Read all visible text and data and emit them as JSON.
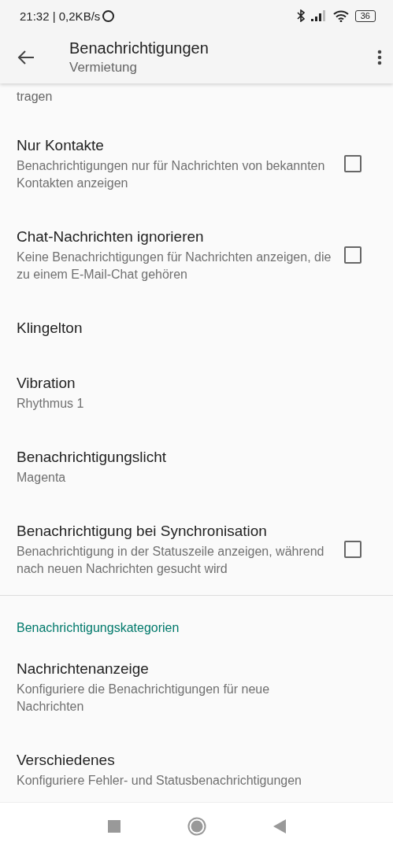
{
  "status_bar": {
    "text": "21:32 | 0,2KB/s",
    "battery": "36"
  },
  "app_bar": {
    "title": "Benachrichtigungen",
    "subtitle": "Vermietung"
  },
  "partial_summary": "tragen",
  "items": [
    {
      "kind": "checkbox",
      "title": "Nur Kontakte",
      "summary": "Benachrichtigungen nur für Nachrichten von bekannten Kontakten anzeigen",
      "checked": false
    },
    {
      "kind": "checkbox",
      "title": "Chat-Nachrichten ignorieren",
      "summary": "Keine Benachrichtigungen für Nachrichten anzeigen, die zu einem E-Mail-Chat gehören",
      "checked": false
    },
    {
      "kind": "plain",
      "title": "Klingelton"
    },
    {
      "kind": "plain",
      "title": "Vibration",
      "summary": "Rhythmus 1"
    },
    {
      "kind": "plain",
      "title": "Benachrichtigungslicht",
      "summary": "Magenta"
    },
    {
      "kind": "checkbox",
      "title": "Benachrichtigung bei Synchronisation",
      "summary": "Benachrichtigung in der Statuszeile anzeigen, während nach neuen Nachrichten gesucht wird",
      "checked": false
    }
  ],
  "category": {
    "title": "Benachrichtigungskategorien",
    "items": [
      {
        "title": "Nachrichtenanzeige",
        "summary": "Konfiguriere die Benachrichtigungen für neue Nachrichten"
      },
      {
        "title": "Verschiedenes",
        "summary": "Konfiguriere Fehler- und Statusbenachrichtigungen"
      }
    ]
  }
}
